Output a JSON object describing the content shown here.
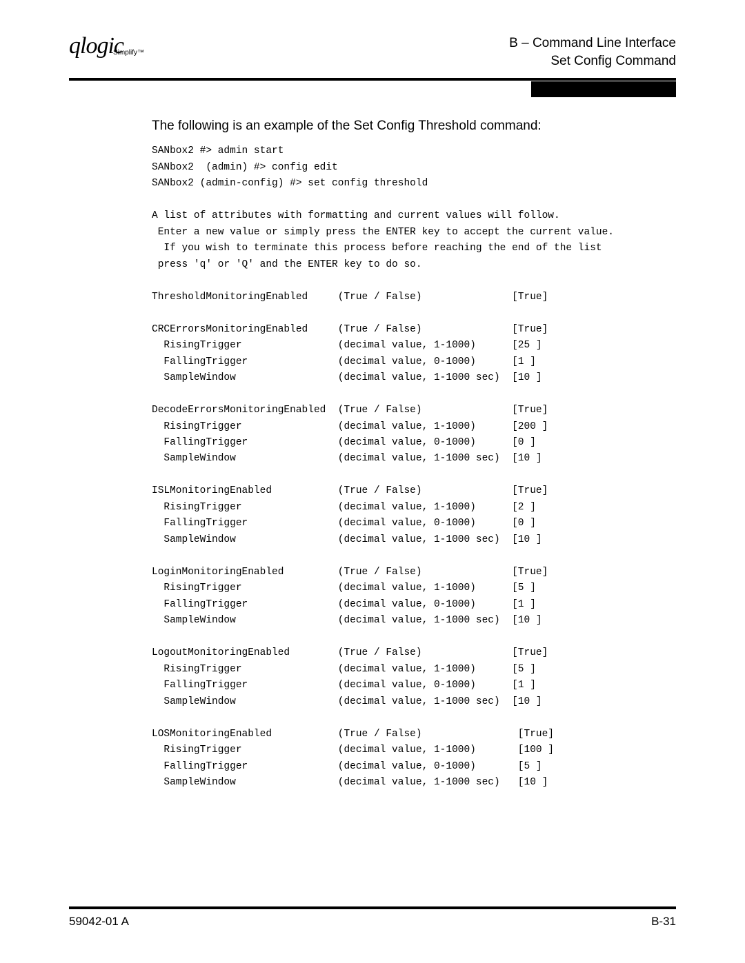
{
  "header": {
    "logo_main": "qlogic",
    "logo_sub": "Simplify™",
    "line1": "B – Command Line Interface",
    "line2": "Set Config Command"
  },
  "intro": "The following is an example of the Set Config Threshold command:",
  "cli": {
    "l1": "SANbox2 #> admin start",
    "l2": "SANbox2  (admin) #> config edit",
    "l3": "SANbox2 (admin-config) #> set config threshold",
    "p1": "A list of attributes with formatting and current values will follow.",
    "p2": " Enter a new value or simply press the ENTER key to accept the current value.",
    "p3": "  If you wish to terminate this process before reaching the end of the list",
    "p4": " press 'q' or 'Q' and the ENTER key to do so."
  },
  "rows": [
    {
      "k": "ThresholdMonitoringEnabled",
      "fmt": "(True / False)",
      "v": "[True]"
    },
    {
      "blank": true
    },
    {
      "k": "CRCErrorsMonitoringEnabled",
      "fmt": "(True / False)",
      "v": "[True]"
    },
    {
      "k": "  RisingTrigger",
      "fmt": "(decimal value, 1-1000)",
      "v": "[25 ]"
    },
    {
      "k": "  FallingTrigger",
      "fmt": "(decimal value, 0-1000)",
      "v": "[1 ]"
    },
    {
      "k": "  SampleWindow",
      "fmt": "(decimal value, 1-1000 sec)",
      "v": "[10 ]"
    },
    {
      "blank": true
    },
    {
      "k": "DecodeErrorsMonitoringEnabled",
      "fmt": "(True / False)",
      "v": "[True]"
    },
    {
      "k": "  RisingTrigger",
      "fmt": "(decimal value, 1-1000)",
      "v": "[200 ]"
    },
    {
      "k": "  FallingTrigger",
      "fmt": "(decimal value, 0-1000)",
      "v": "[0 ]"
    },
    {
      "k": "  SampleWindow",
      "fmt": "(decimal value, 1-1000 sec)",
      "v": "[10 ]"
    },
    {
      "blank": true
    },
    {
      "k": "ISLMonitoringEnabled",
      "fmt": "(True / False)",
      "v": "[True]"
    },
    {
      "k": "  RisingTrigger",
      "fmt": "(decimal value, 1-1000)",
      "v": "[2 ]"
    },
    {
      "k": "  FallingTrigger",
      "fmt": "(decimal value, 0-1000)",
      "v": "[0 ]"
    },
    {
      "k": "  SampleWindow",
      "fmt": "(decimal value, 1-1000 sec)",
      "v": "[10 ]"
    },
    {
      "blank": true
    },
    {
      "k": "LoginMonitoringEnabled",
      "fmt": "(True / False)",
      "v": "[True]"
    },
    {
      "k": "  RisingTrigger",
      "fmt": "(decimal value, 1-1000)",
      "v": "[5 ]"
    },
    {
      "k": "  FallingTrigger",
      "fmt": "(decimal value, 0-1000)",
      "v": "[1 ]"
    },
    {
      "k": "  SampleWindow",
      "fmt": "(decimal value, 1-1000 sec)",
      "v": "[10 ]"
    },
    {
      "blank": true
    },
    {
      "k": "LogoutMonitoringEnabled",
      "fmt": "(True / False)",
      "v": "[True]"
    },
    {
      "k": "  RisingTrigger",
      "fmt": "(decimal value, 1-1000)",
      "v": "[5 ]"
    },
    {
      "k": "  FallingTrigger",
      "fmt": "(decimal value, 0-1000)",
      "v": "[1 ]"
    },
    {
      "k": "  SampleWindow",
      "fmt": "(decimal value, 1-1000 sec)",
      "v": "[10 ]"
    },
    {
      "blank": true
    },
    {
      "k": "LOSMonitoringEnabled",
      "fmt": "(True / False)",
      "v": " [True]"
    },
    {
      "k": "  RisingTrigger",
      "fmt": "(decimal value, 1-1000)",
      "v": " [100 ]"
    },
    {
      "k": "  FallingTrigger",
      "fmt": "(decimal value, 0-1000)",
      "v": " [5 ]"
    },
    {
      "k": "  SampleWindow",
      "fmt": "(decimal value, 1-1000 sec)",
      "v": " [10 ]"
    }
  ],
  "footer": {
    "left": "59042-01 A",
    "right": "B-31"
  }
}
